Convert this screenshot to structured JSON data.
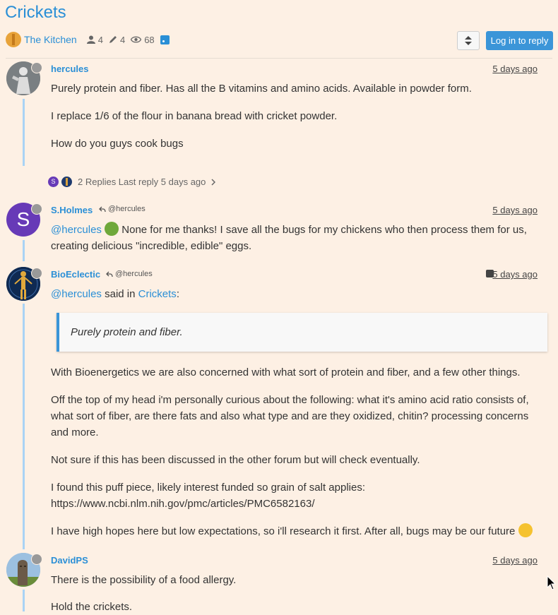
{
  "topic": {
    "title": "Crickets",
    "category": "The Kitchen",
    "posters_count": "4",
    "posts_count": "4",
    "views_count": "68"
  },
  "toolbar": {
    "login_reply_label": "Log in to reply"
  },
  "posts": [
    {
      "username": "hercules",
      "time": "5 days ago",
      "paragraphs": [
        "Purely protein and fiber. Has all the B vitamins and amino acids. Available in powder form.",
        "I replace 1/6 of the flour in banana bread with cricket powder.",
        "How do you guys cook bugs"
      ],
      "replies_summary": "2 Replies Last reply 5 days ago",
      "reply_avatar_letter": "S"
    },
    {
      "username": "S.Holmes",
      "avatar_letter": "S",
      "parent": "@hercules",
      "time": "5 days ago",
      "mention": "@hercules",
      "text": "None for me thanks! I save all the bugs for my chickens who then process them for us, creating delicious \"incredible, edible\" eggs."
    },
    {
      "username": "BioEclectic",
      "parent": "@hercules",
      "time": "5 days ago",
      "mention": "@hercules",
      "said_in": "said in",
      "topic_link": "Crickets",
      "colon": ":",
      "quote": "Purely protein and fiber.",
      "paragraphs": [
        "With Bioenergetics we are also concerned with what sort of protein and fiber, and a few other things.",
        "Off the top of my head i'm personally curious about the following: what it's amino acid ratio consists of, what sort of fiber, are there fats and also what type and are they oxidized, chitin? processing concerns and more.",
        "Not sure if this has been discussed in the other forum but will check eventually.",
        "I found this puff piece, likely interest funded so grain of salt applies:",
        "I have high hopes here but low expectations, so i'll research it first. After all, bugs may be our future"
      ],
      "link": "https://www.ncbi.nlm.nih.gov/pmc/articles/PMC6582163/"
    },
    {
      "username": "DavidPS",
      "time": "5 days ago",
      "text": "There is the possibility of a food allergy.",
      "link_text": "Hold the crickets."
    }
  ],
  "colors": {
    "accent": "#2a8fd6",
    "thread_line": "#a9d3f5",
    "background": "#fdf0e4",
    "holmes_avatar": "#673ab7"
  }
}
